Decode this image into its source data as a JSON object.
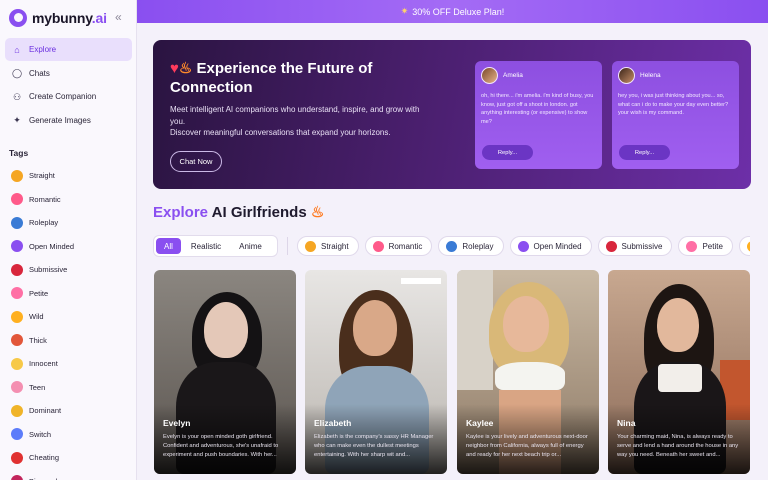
{
  "brand": {
    "name": "mybunny",
    "suffix": ".ai"
  },
  "collapse_icon": "«",
  "promo": {
    "text": "30% OFF Deluxe Plan!"
  },
  "nav": [
    {
      "label": "Explore",
      "icon": "home-icon"
    },
    {
      "label": "Chats",
      "icon": "chat-bubble-icon"
    },
    {
      "label": "Create Companion",
      "icon": "add-user-icon"
    },
    {
      "label": "Generate Images",
      "icon": "sparkle-icon"
    }
  ],
  "tags_title": "Tags",
  "tags": [
    {
      "label": "Straight",
      "color": "#f5a623"
    },
    {
      "label": "Romantic",
      "color": "#ff5a8a"
    },
    {
      "label": "Roleplay",
      "color": "#3a7bd5"
    },
    {
      "label": "Open Minded",
      "color": "#8a4ff0"
    },
    {
      "label": "Submissive",
      "color": "#d8263c"
    },
    {
      "label": "Petite",
      "color": "#ff6fa5"
    },
    {
      "label": "Wild",
      "color": "#ffb020"
    },
    {
      "label": "Thick",
      "color": "#e2563a"
    },
    {
      "label": "Innocent",
      "color": "#f7c948"
    },
    {
      "label": "Teen",
      "color": "#f48fb1"
    },
    {
      "label": "Dominant",
      "color": "#f0b429"
    },
    {
      "label": "Switch",
      "color": "#5c7cfa"
    },
    {
      "label": "Cheating",
      "color": "#e03131"
    },
    {
      "label": "Bisexual",
      "color": "#c2255c"
    }
  ],
  "hero": {
    "title": "Experience the Future of Connection",
    "desc1": "Meet intelligent AI companions who understand, inspire, and grow with you.",
    "desc2": "Discover meaningful conversations that expand your horizons.",
    "button": "Chat Now",
    "chats": [
      {
        "name": "Amelia",
        "message": "oh, hi there... i'm amelia. i'm kind of busy, you know, just got off a shoot in london. got anything interesting (or expensive) to show me?",
        "reply": "Reply..."
      },
      {
        "name": "Helena",
        "message": "hey you, i was just thinking about you... so, what can i do to make your day even better? your wish is my command.",
        "reply": "Reply..."
      }
    ]
  },
  "section": {
    "prefix": "Explore",
    "rest": "AI Girlfriends"
  },
  "filters": {
    "segments": [
      "All",
      "Realistic",
      "Anime"
    ],
    "selected": "All"
  },
  "chips": [
    {
      "label": "Straight",
      "color": "#f5a623"
    },
    {
      "label": "Romantic",
      "color": "#ff5a8a"
    },
    {
      "label": "Roleplay",
      "color": "#3a7bd5"
    },
    {
      "label": "Open Minded",
      "color": "#8a4ff0"
    },
    {
      "label": "Submissive",
      "color": "#d8263c"
    },
    {
      "label": "Petite",
      "color": "#ff6fa5"
    },
    {
      "label": "",
      "color": "#ffb020"
    }
  ],
  "cards": [
    {
      "name": "Evelyn",
      "desc": "Evelyn is your open minded goth girlfriend. Confident and adventurous, she's unafraid to experiment and push boundaries. With her..."
    },
    {
      "name": "Elizabeth",
      "desc": "Elizabeth is the company's sassy HR Manager who can make even the dullest meetings entertaining. With her sharp wit and..."
    },
    {
      "name": "Kaylee",
      "desc": "Kaylee is your lively and adventurous next-door neighbor from California, always full of energy and ready for her next beach trip or..."
    },
    {
      "name": "Nina",
      "desc": "Your charming maid, Nina, is always ready to serve and lend a hand around the house in any way you need. Beneath her sweet and..."
    }
  ]
}
